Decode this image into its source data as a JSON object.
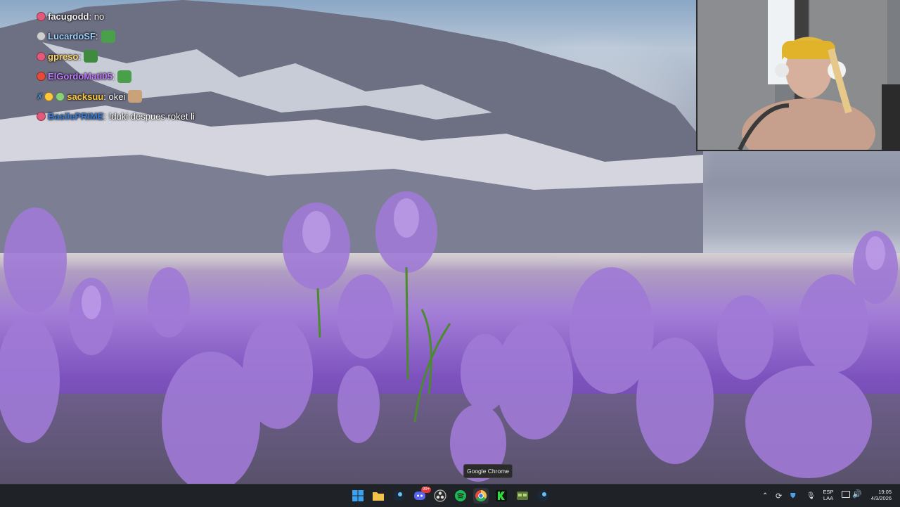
{
  "chat": [
    {
      "user": "facugodd",
      "user_color": "#f2f2f2",
      "message": "no",
      "badge_color": "#e25a7b",
      "emote": false
    },
    {
      "user": "LucardoSF",
      "user_color": "#9ed0ff",
      "message": "",
      "badge_color": "#cfcfcf",
      "emote": true,
      "emote_color": "#4aa04a"
    },
    {
      "user": "gpreso",
      "user_color": "#ffd56a",
      "message": "",
      "badge_color": "#e25a7b",
      "emote": true,
      "emote_color": "#3e8a3e"
    },
    {
      "user": "ElGordoMati05",
      "user_color": "#c07cff",
      "message": "",
      "badge_color": "#e84a3a",
      "emote": true,
      "emote_color": "#4aa04a"
    },
    {
      "user": "sacksuu",
      "user_color": "#ffc83a",
      "message": "okei",
      "badge_color": "#3aa0e8",
      "emote": true,
      "emote_color": "#c9a27a"
    },
    {
      "user": "BasilePRIME",
      "user_color": "#3a7bd5",
      "message": "!duki despues roket li",
      "badge_color": "#e25a7b",
      "emote": false
    }
  ],
  "tooltip": "Google Chrome",
  "taskbar": {
    "apps": [
      {
        "name": "windows-start",
        "color": "#3aa0f0"
      },
      {
        "name": "file-explorer",
        "color": "#f2c24a"
      },
      {
        "name": "steam",
        "color": "#3a6f9c"
      },
      {
        "name": "discord",
        "color": "#5865f2"
      },
      {
        "name": "obs",
        "color": "#444"
      },
      {
        "name": "spotify",
        "color": "#1db954"
      },
      {
        "name": "chrome",
        "color": "#e84a3a"
      },
      {
        "name": "kick",
        "color": "#2bdc3a"
      },
      {
        "name": "app-green",
        "color": "#5a7a3a"
      },
      {
        "name": "steam-2",
        "color": "#3a6f9c"
      }
    ],
    "discord_badge": "99+",
    "lang_top": "ESP",
    "lang_bottom": "LAA",
    "time": "19:05",
    "date": "4/3/2026"
  }
}
